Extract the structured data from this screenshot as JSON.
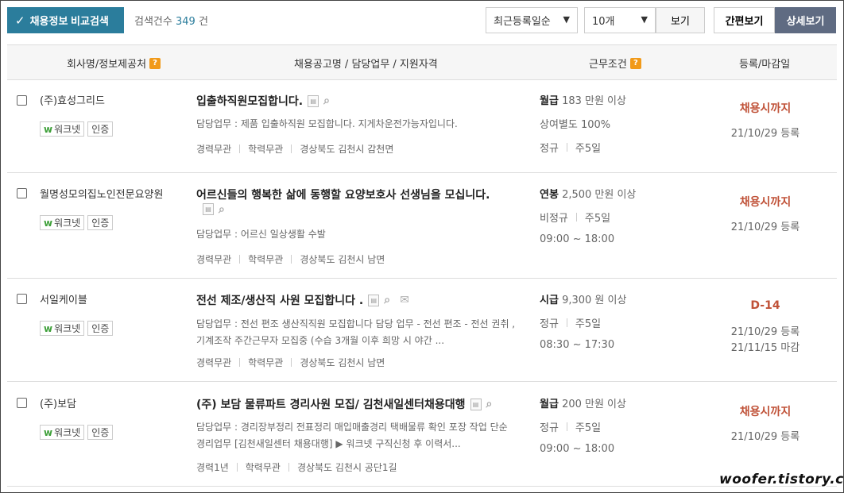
{
  "toolbar": {
    "compare_label": "채용정보 비교검색",
    "count_label": "검색건수",
    "count_value": "349",
    "count_unit": "건",
    "sort_selected": "최근등록일순",
    "per_page_selected": "10개",
    "view_button": "보기",
    "simple_view": "간편보기",
    "detail_view": "상세보기"
  },
  "header": {
    "company": "회사명/정보제공처",
    "posting": "채용공고명 / 담당업무 / 지원자격",
    "condition": "근무조건",
    "dates": "등록/마감일"
  },
  "badges": {
    "worknet": "워크넷",
    "certified": "인증"
  },
  "rows": [
    {
      "company": "(주)효성그리드",
      "title": "입출하직원모집합니다.",
      "duty": "담당업무 : 제품 입출하직원 모집합니다. 지게차운전가능자입니다.",
      "duty2": "",
      "career": "경력무관",
      "education": "학력무관",
      "location": "경상북도 김천시 감천면",
      "pay_type": "월급",
      "pay": "183 만원 이상",
      "cond2": "상여별도 100%",
      "emp_type": "정규",
      "work_days": "주5일",
      "hours": "",
      "deadline": "채용시까지",
      "registered": "21/10/29 등록",
      "closing": ""
    },
    {
      "company": "월명성모의집노인전문요양원",
      "title": "어르신들의 행복한 삶에 동행할 요양보호사 선생님을 모십니다.",
      "duty": "담당업무 : 어르신 일상생활 수발",
      "duty2": "",
      "career": "경력무관",
      "education": "학력무관",
      "location": "경상북도 김천시 남면",
      "pay_type": "연봉",
      "pay": "2,500 만원 이상",
      "cond2": "",
      "emp_type": "비정규",
      "work_days": "주5일",
      "hours": "09:00 ~ 18:00",
      "deadline": "채용시까지",
      "registered": "21/10/29 등록",
      "closing": ""
    },
    {
      "company": "서일케이블",
      "title": "전선 제조/생산직 사원 모집합니다 .",
      "duty": "담당업무 : 전선 편조 생산직직원 모집합니다 담당 업무 - 전선 편조 - 전선 권취 ,",
      "duty2": "기계조작 주간근무자 모집중 (수습 3개월 이후 희망 시 야간 ...",
      "career": "경력무관",
      "education": "학력무관",
      "location": "경상북도 김천시 남면",
      "pay_type": "시급",
      "pay": "9,300 원 이상",
      "cond2": "",
      "emp_type": "정규",
      "work_days": "주5일",
      "hours": "08:30 ~ 17:30",
      "deadline": "D-14",
      "registered": "21/10/29 등록",
      "closing": "21/11/15 마감"
    },
    {
      "company": "(주)보담",
      "title": "(주) 보담 물류파트 경리사원 모집/ 김천새일센터채용대행",
      "duty": "담당업무 : 경리장부정리 전표정리 매입매출경리 택배물류 확인 포장 작업 단순",
      "duty2": "경리업무 [김천새일센터 채용대행] ▶ 워크넷 구직신청 후 이력서...",
      "career": "경력1년",
      "education": "학력무관",
      "location": "경상북도 김천시 공단1길",
      "pay_type": "월급",
      "pay": "200 만원 이상",
      "cond2": "",
      "emp_type": "정규",
      "work_days": "주5일",
      "hours": "09:00 ~ 18:00",
      "deadline": "채용시까지",
      "registered": "21/10/29 등록",
      "closing": ""
    }
  ],
  "watermark": "woofer.tistory.com"
}
